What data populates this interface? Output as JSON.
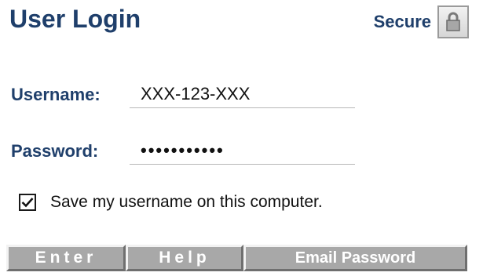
{
  "header": {
    "title": "User Login",
    "secure_label": "Secure",
    "secure_icon": "lock-icon"
  },
  "form": {
    "username_label": "Username:",
    "username_value": "XXX-123-XXX",
    "password_label": "Password:",
    "password_value": "•••••••••••",
    "remember_checked": true,
    "remember_label": "Save my username on this computer."
  },
  "buttons": {
    "enter_label": "Enter",
    "help_label": "Help",
    "email_password_label": "Email Password"
  },
  "colors": {
    "heading": "#1f3f6b",
    "button_face": "#a8a8a8",
    "button_text": "#ffffff"
  }
}
